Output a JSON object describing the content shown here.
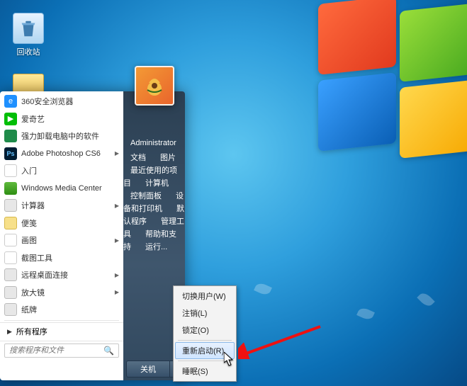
{
  "desktop": {
    "recycle_bin": "回收站"
  },
  "start": {
    "programs": [
      {
        "label": "360安全浏览器",
        "icon": "ie",
        "has_sub": false
      },
      {
        "label": "爱奇艺",
        "icon": "iqy",
        "has_sub": false
      },
      {
        "label": "强力卸载电脑中的软件",
        "icon": "unin",
        "has_sub": false
      },
      {
        "label": "Adobe Photoshop CS6",
        "icon": "ps",
        "has_sub": true
      },
      {
        "label": "入门",
        "icon": "doc",
        "has_sub": false
      },
      {
        "label": "Windows Media Center",
        "icon": "wmc",
        "has_sub": false
      },
      {
        "label": "计算器",
        "icon": "calc",
        "has_sub": true
      },
      {
        "label": "便笺",
        "icon": "note",
        "has_sub": false
      },
      {
        "label": "画图",
        "icon": "paint",
        "has_sub": true
      },
      {
        "label": "截图工具",
        "icon": "snip",
        "has_sub": false
      },
      {
        "label": "远程桌面连接",
        "icon": "rdp",
        "has_sub": true
      },
      {
        "label": "放大镜",
        "icon": "magni",
        "has_sub": true
      },
      {
        "label": "纸牌",
        "icon": "zhipai",
        "has_sub": false
      }
    ],
    "all_programs": "所有程序",
    "search_placeholder": "搜索程序和文件"
  },
  "right": {
    "user": "Administrator",
    "items": [
      "文档",
      "图片",
      "最近使用的项目",
      "计算机",
      "控制面板",
      "设备和打印机",
      "默认程序",
      "管理工具",
      "帮助和支持",
      "运行..."
    ],
    "shutdown": "关机"
  },
  "submenu": {
    "items": [
      "切换用户(W)",
      "注销(L)",
      "锁定(O)",
      "重新启动(R)",
      "睡眠(S)"
    ],
    "highlighted_index": 3
  }
}
